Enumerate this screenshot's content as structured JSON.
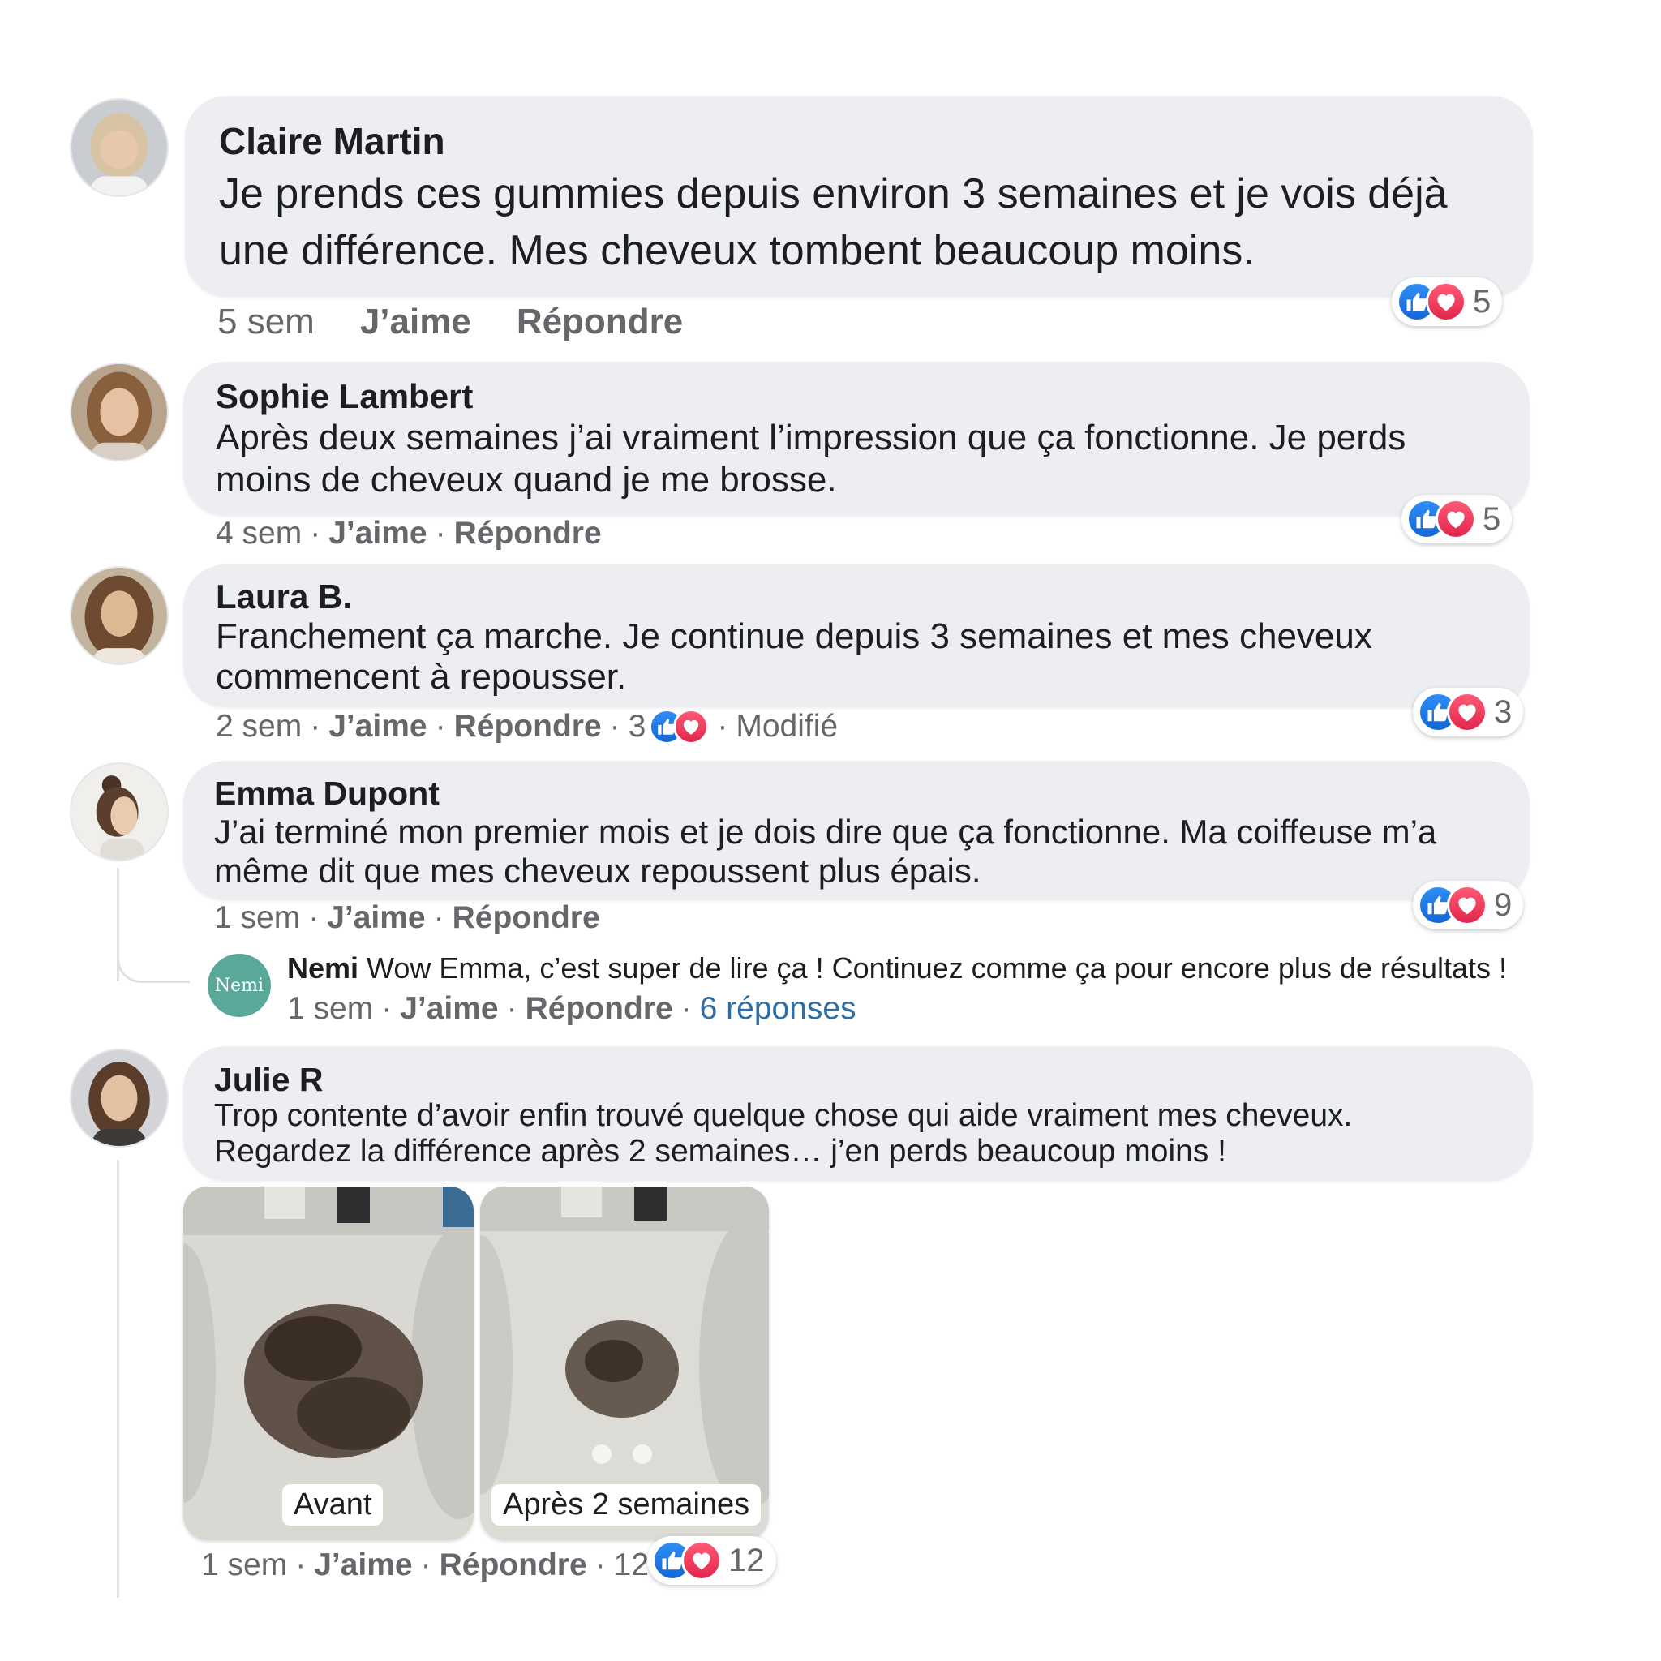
{
  "colors": {
    "bubble_bg": "#eceef2",
    "meta_text": "#65676b",
    "link": "#2d6ea5",
    "like_blue": "#1877f2",
    "love_red": "#f33e58",
    "nemi_teal": "#5aa89a"
  },
  "comments": [
    {
      "author": "Claire Martin",
      "text_line1": "Je prends ces gummies depuis environ 3 semaines et je vois déjà",
      "text_line2": "une différence. Mes cheveux tombent beaucoup moins.",
      "time": "5 sem",
      "like": "J’aime",
      "reply": "Répondre",
      "reaction_count": "5",
      "reaction_icons": [
        "like-icon",
        "love-icon"
      ]
    },
    {
      "author": "Sophie Lambert",
      "text_line1": "Après deux semaines j’ai vraiment l’impression que ça fonctionne. Je perds",
      "text_line2": "moins de cheveux quand je me brosse.",
      "time": "4 sem",
      "like": "J’aime",
      "reply": "Répondre",
      "reaction_count": "5",
      "reaction_icons": [
        "like-icon",
        "love-icon"
      ]
    },
    {
      "author": "Laura B.",
      "text_line1": "Franchement ça marche. Je continue depuis 3 semaines et mes cheveux",
      "text_line2": "commencent à repousser.",
      "time": "2 sem",
      "like": "J’aime",
      "reply": "Répondre",
      "inline_count": "3",
      "edited": "Modifié",
      "reaction_count": "3",
      "reaction_icons": [
        "like-icon",
        "love-icon"
      ]
    },
    {
      "author": "Emma Dupont",
      "text_line1": "J’ai terminé mon premier mois et je dois dire que ça fonctionne. Ma coiffeuse m’a",
      "text_line2": "même dit que mes cheveux repoussent plus épais.",
      "time": "1 sem",
      "like": "J’aime",
      "reply": "Répondre",
      "reaction_count": "9",
      "reaction_icons": [
        "like-icon",
        "love-icon"
      ],
      "reply_thread": {
        "logo_text": "Nemi",
        "author": "Nemi",
        "text": "Wow Emma, c’est super de lire ça ! Continuez comme ça pour encore plus de résultats !",
        "time": "1 sem",
        "like": "J’aime",
        "reply": "Répondre",
        "replies_link": "6 réponses"
      }
    },
    {
      "author": "Julie R",
      "text_line1": "Trop contente d’avoir enfin trouvé quelque chose qui aide vraiment mes cheveux.",
      "text_line2": "Regardez la différence après 2 semaines… j’en perds beaucoup moins !",
      "time": "1 sem",
      "like": "J’aime",
      "reply": "Répondre",
      "inline_count": "12",
      "reaction_count": "12",
      "reaction_icons": [
        "like-icon",
        "love-icon"
      ],
      "photos": [
        {
          "label": "Avant",
          "amount_relative": 1.0
        },
        {
          "label": "Après 2 semaines",
          "amount_relative": 0.5
        }
      ]
    }
  ]
}
